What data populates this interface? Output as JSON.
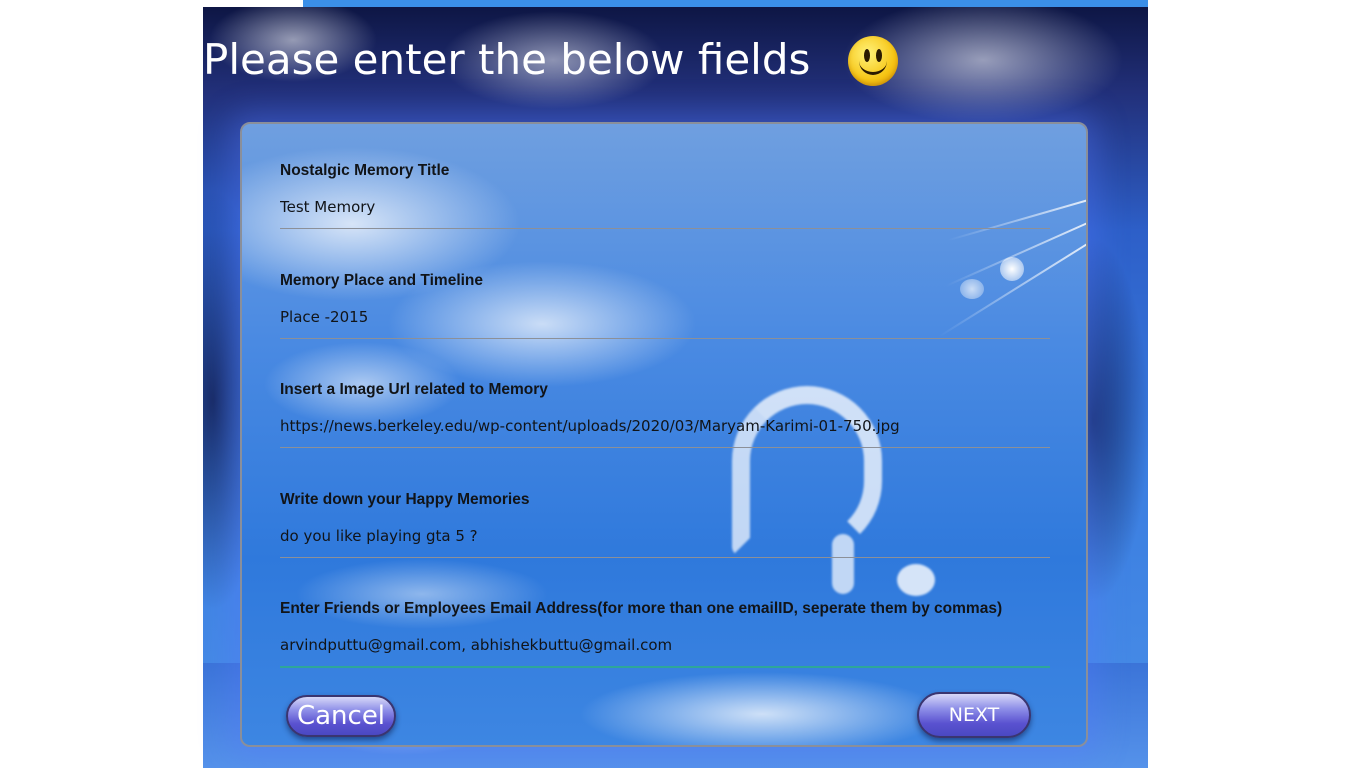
{
  "page": {
    "heading": "Please enter the below fields",
    "emoji": "smiley-face-icon"
  },
  "form": {
    "fields": [
      {
        "label": "Nostalgic Memory Title",
        "value": "Test Memory"
      },
      {
        "label": "Memory Place and Timeline",
        "value": "Place -2015"
      },
      {
        "label": "Insert a Image Url related to Memory",
        "value": "https://news.berkeley.edu/wp-content/uploads/2020/03/Maryam-Karimi-01-750.jpg"
      },
      {
        "label": "Write down your Happy Memories",
        "value": "do you like playing gta 5 ?"
      },
      {
        "label": "Enter Friends or Employees Email Address(for more than one emailID, seperate them by commas)",
        "value": "arvindputtu@gmail.com, abhishekbuttu@gmail.com "
      }
    ],
    "cancel_label": "Cancel",
    "next_label": "NEXT"
  },
  "colors": {
    "accent_underline": "#2ea69a",
    "button_gradient_top": "#d7d8f8",
    "button_gradient_bottom": "#4a48c2"
  }
}
